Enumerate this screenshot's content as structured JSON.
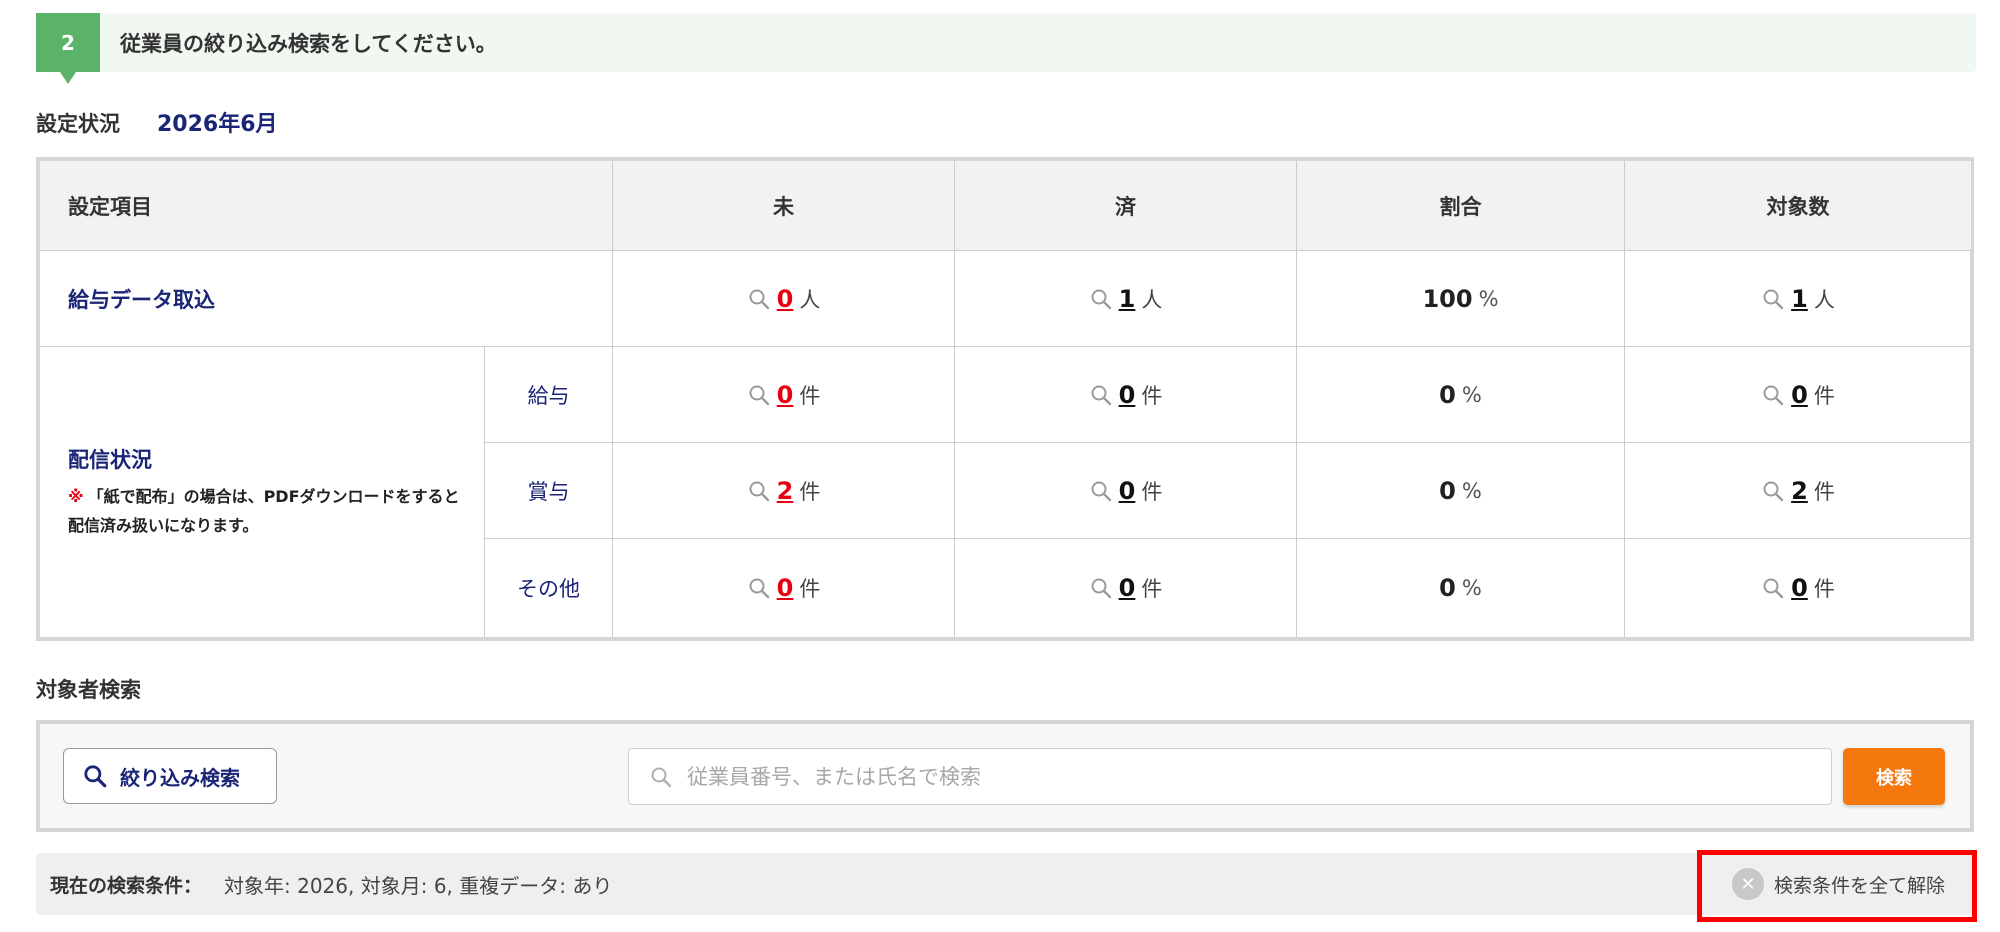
{
  "step": {
    "number": "2",
    "title": "従業員の絞り込み検索をしてください。"
  },
  "status": {
    "label": "設定状況",
    "date": "2026年6月"
  },
  "table": {
    "headers": {
      "item": "設定項目",
      "pending": "未",
      "done": "済",
      "ratio": "割合",
      "count": "対象数"
    },
    "rows": [
      {
        "label": "給与データ取込",
        "pending": "0",
        "pending_unit": "人",
        "done": "1",
        "done_unit": "人",
        "ratio": "100",
        "ratio_unit": "%",
        "count": "1",
        "count_unit": "人"
      }
    ],
    "delivery": {
      "title": "配信状況",
      "note_mark": "※",
      "note": "「紙で配布」の場合は、PDFダウンロードをすると配信済み扱いになります。",
      "rows": [
        {
          "label": "給与",
          "pending": "0",
          "unit": "件",
          "done": "0",
          "ratio": "0",
          "ratio_unit": "%",
          "count": "0"
        },
        {
          "label": "賞与",
          "pending": "2",
          "unit": "件",
          "done": "0",
          "ratio": "0",
          "ratio_unit": "%",
          "count": "2"
        },
        {
          "label": "その他",
          "pending": "0",
          "unit": "件",
          "done": "0",
          "ratio": "0",
          "ratio_unit": "%",
          "count": "0"
        }
      ]
    }
  },
  "search": {
    "heading": "対象者検索",
    "filter_button": "絞り込み検索",
    "placeholder": "従業員番号、または氏名で検索",
    "value": "",
    "submit": "検索"
  },
  "conditions": {
    "label": "現在の検索条件：",
    "value": "対象年: 2026, 対象月: 6, 重複データ: あり",
    "clear": "検索条件を全て解除"
  },
  "colors": {
    "accent_green": "#5bb36a",
    "navy": "#1a2576",
    "red": "#e60012",
    "orange": "#f5780f",
    "highlight": "#ff0000"
  }
}
